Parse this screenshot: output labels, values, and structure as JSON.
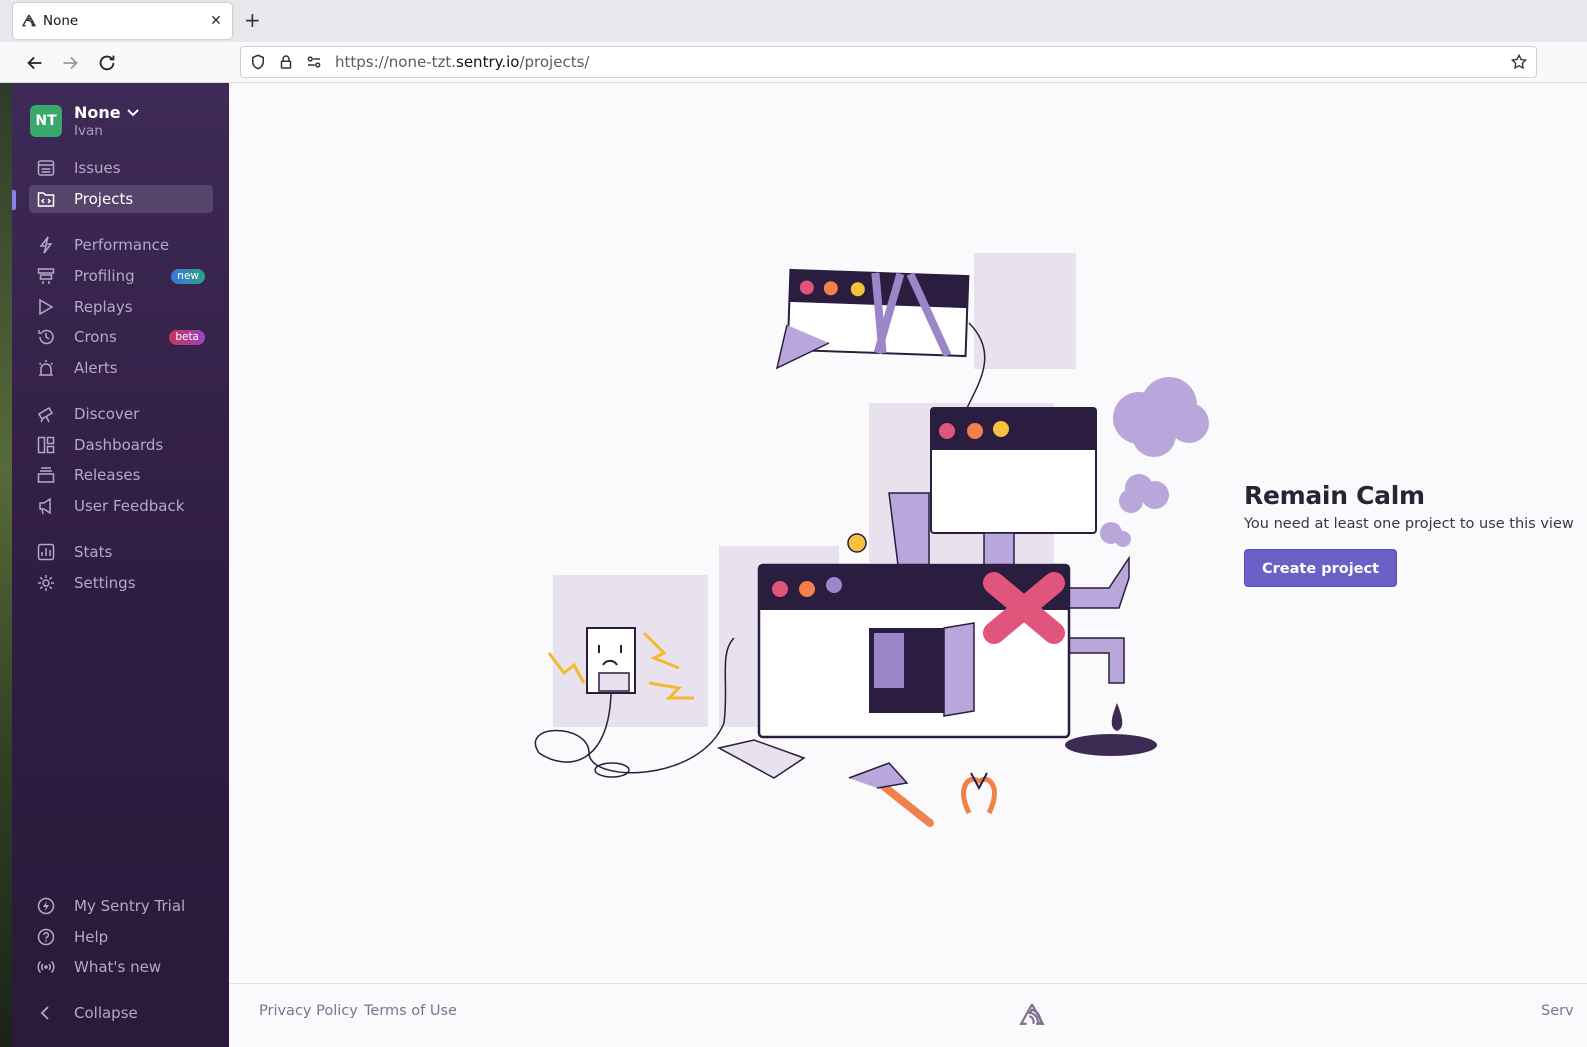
{
  "browser": {
    "tab_title": "None",
    "url_prefix": "https://none-tzt.",
    "url_domain": "sentry.io",
    "url_path": "/projects/"
  },
  "org": {
    "initials": "NT",
    "name": "None",
    "user": "Ivan"
  },
  "sidebar": {
    "items": [
      {
        "label": "Issues",
        "icon": "issues-icon"
      },
      {
        "label": "Projects",
        "icon": "projects-icon"
      },
      {
        "label": "Performance",
        "icon": "lightning-icon"
      },
      {
        "label": "Profiling",
        "icon": "profiling-icon",
        "badge": "new"
      },
      {
        "label": "Replays",
        "icon": "play-icon"
      },
      {
        "label": "Crons",
        "icon": "clock-icon",
        "badge": "beta"
      },
      {
        "label": "Alerts",
        "icon": "siren-icon"
      },
      {
        "label": "Discover",
        "icon": "telescope-icon"
      },
      {
        "label": "Dashboards",
        "icon": "dashboard-icon"
      },
      {
        "label": "Releases",
        "icon": "box-icon"
      },
      {
        "label": "User Feedback",
        "icon": "megaphone-icon"
      },
      {
        "label": "Stats",
        "icon": "stats-icon"
      },
      {
        "label": "Settings",
        "icon": "gear-icon"
      }
    ],
    "bottom": [
      {
        "label": "My Sentry Trial",
        "icon": "lightning-circle-icon"
      },
      {
        "label": "Help",
        "icon": "question-icon"
      },
      {
        "label": "What's new",
        "icon": "broadcast-icon"
      },
      {
        "label": "Collapse",
        "icon": "chevron-left-icon"
      }
    ]
  },
  "empty_state": {
    "title": "Remain Calm",
    "message": "You need at least one project to use this view",
    "button": "Create project"
  },
  "footer": {
    "privacy": "Privacy Policy",
    "terms": "Terms of Use",
    "status_cut": "Serv"
  },
  "colors": {
    "sidebar_top": "#3e2a56",
    "accent": "#6c5fc7",
    "avatar": "#3ba86b"
  }
}
